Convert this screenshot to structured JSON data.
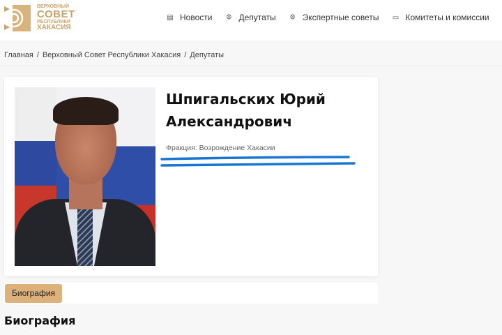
{
  "logo": {
    "line1": "ВЕРХОВНЫЙ",
    "line2": "СОВЕТ",
    "line3": "РЕСПУБЛИКИ",
    "line4": "ХАКАСИЯ",
    "color": "#c9a46a"
  },
  "nav": [
    {
      "label": "Новости",
      "icon": "newspaper-icon"
    },
    {
      "label": "Депутаты",
      "icon": "people-icon"
    },
    {
      "label": "Экспертные советы",
      "icon": "people-icon"
    },
    {
      "label": "Комитеты и комиссии",
      "icon": "monitor-icon"
    }
  ],
  "breadcrumbs": [
    "Главная",
    "Верховный Совет Республики Хакасия",
    "Депутаты"
  ],
  "deputy": {
    "name": "Шпигальских Юрий Александрович",
    "faction": "Фракция: Возрождение Хакасии"
  },
  "tabs": [
    {
      "label": "Биография",
      "active": true
    }
  ],
  "section_title": "Биография",
  "accent": "#ddb27a"
}
